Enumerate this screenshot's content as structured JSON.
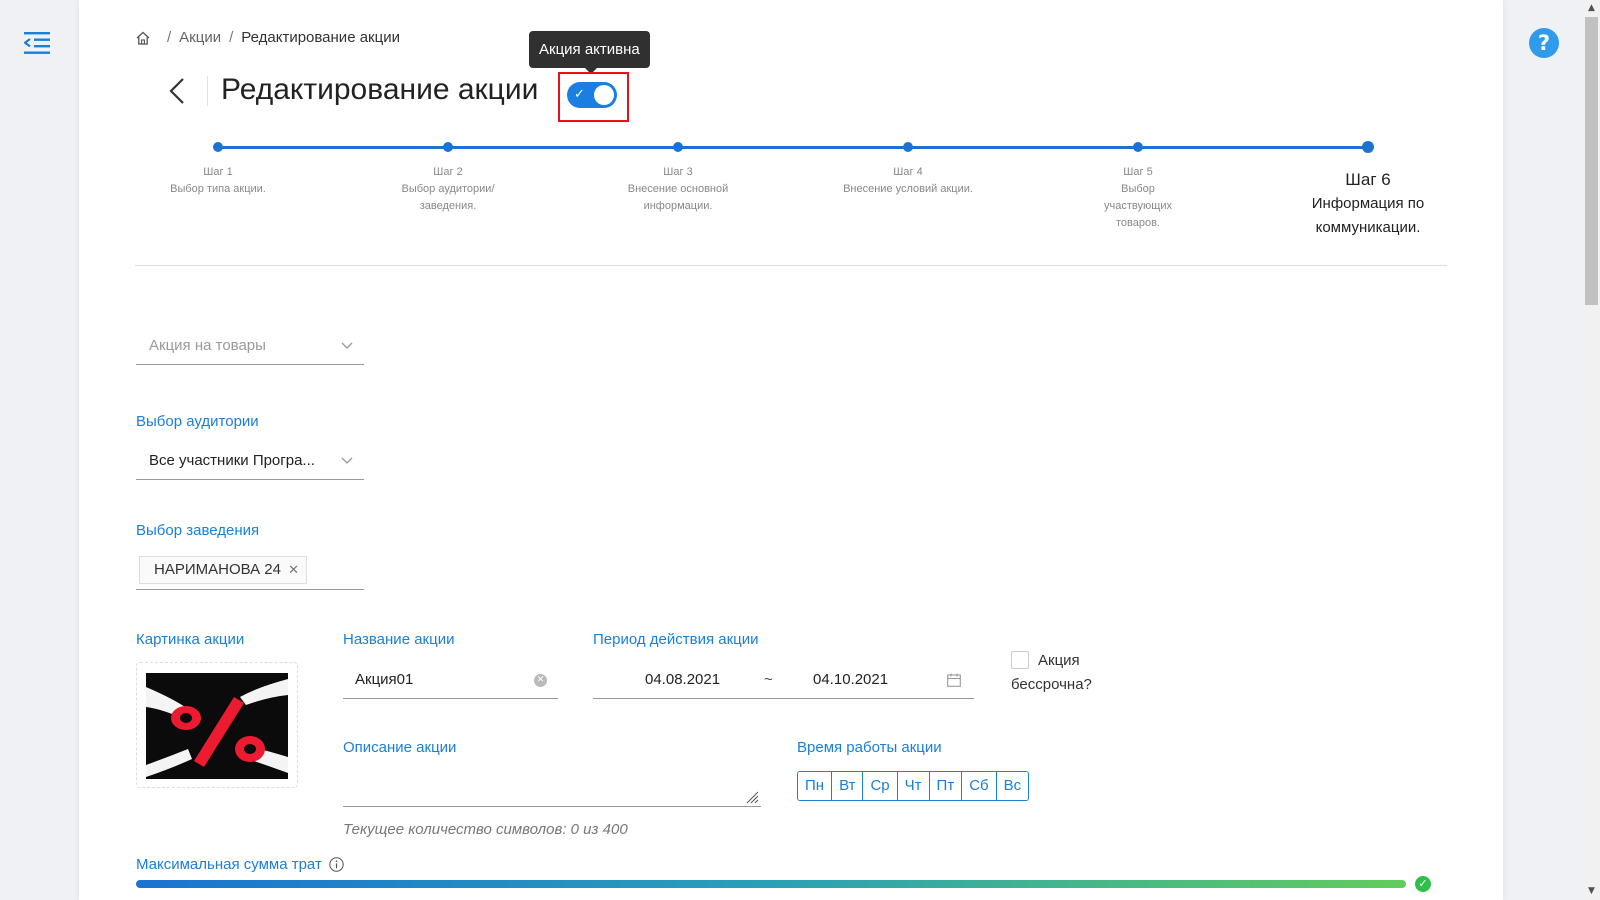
{
  "breadcrumb": {
    "items": [
      "Акции",
      "Редактирование акции"
    ]
  },
  "header": {
    "title": "Редактирование акции",
    "toggle_tooltip": "Акция активна",
    "toggle_on": true
  },
  "stepper": {
    "steps": [
      {
        "title": "Шаг 1",
        "desc": "Выбор типа акции."
      },
      {
        "title": "Шаг 2",
        "desc": "Выбор аудитории/заведения."
      },
      {
        "title": "Шаг 3",
        "desc": "Внесение основной информации."
      },
      {
        "title": "Шаг 4",
        "desc": "Внесение условий акции."
      },
      {
        "title": "Шаг 5",
        "desc": "Выбор участвующих товаров."
      },
      {
        "title": "Шаг 6",
        "desc": "Информация по коммуникации."
      }
    ],
    "active_step": 6
  },
  "form": {
    "promo_type": {
      "placeholder": "Акция на товары"
    },
    "audience": {
      "label": "Выбор аудитории",
      "value": "Все участники Програ..."
    },
    "establishment": {
      "label": "Выбор заведения",
      "chips": [
        "НАРИМАНОВА 24"
      ]
    },
    "image": {
      "label": "Картинка акции"
    },
    "name": {
      "label": "Название акции",
      "value": "Акция01"
    },
    "period": {
      "label": "Период действия акции",
      "start": "04.08.2021",
      "separator": "~",
      "end": "04.10.2021"
    },
    "perpetual": {
      "label": "Акция бессрочна?",
      "checked": false
    },
    "description": {
      "label": "Описание акции",
      "char_count": "Текущее количество символов: 0 из 400"
    },
    "work_time": {
      "label": "Время работы акции",
      "days": [
        "Пн",
        "Вт",
        "Ср",
        "Чт",
        "Пт",
        "Сб",
        "Вс"
      ]
    },
    "max_spend": {
      "label": "Максимальная сумма трат",
      "progress_fraction": 1.0
    }
  },
  "colors": {
    "accent": "#1a7fd7",
    "toggle": "#1a7fe0",
    "highlight": "#e8101a",
    "success": "#2fbf4a"
  },
  "icons": [
    "menu-collapse-icon",
    "home-icon",
    "back-arrow-icon",
    "check-icon",
    "chevron-down-icon",
    "clear-icon",
    "calendar-icon",
    "resize-handle-icon",
    "info-icon",
    "help-icon"
  ]
}
